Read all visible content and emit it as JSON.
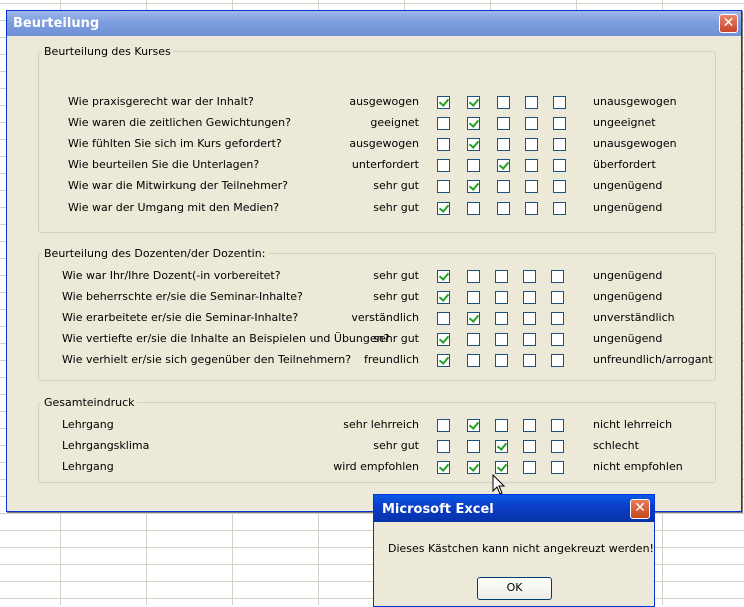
{
  "dialog": {
    "title": "Beurteilung",
    "close_glyph": "✕",
    "groups": [
      {
        "legend": "Beurteilung des Kurses",
        "rows": [
          {
            "question": "Wie praxisgerecht war der Inhalt?",
            "left": "ausgewogen",
            "right": "unausgewogen",
            "checks": [
              true,
              true,
              false,
              false,
              false
            ]
          },
          {
            "question": "Wie waren die zeitlichen Gewichtungen?",
            "left": "geeignet",
            "right": "ungeeignet",
            "checks": [
              false,
              true,
              false,
              false,
              false
            ]
          },
          {
            "question": "Wie fühlten Sie sich im Kurs gefordert?",
            "left": "ausgewogen",
            "right": "unausgewogen",
            "checks": [
              false,
              true,
              false,
              false,
              false
            ]
          },
          {
            "question": "Wie beurteilen Sie die Unterlagen?",
            "left": "unterfordert",
            "right": "überfordert",
            "checks": [
              false,
              false,
              true,
              false,
              false
            ]
          },
          {
            "question": "Wie war die Mitwirkung der Teilnehmer?",
            "left": "sehr gut",
            "right": "ungenügend",
            "checks": [
              false,
              true,
              false,
              false,
              false
            ]
          },
          {
            "question": "Wie war der Umgang mit den Medien?",
            "left": "sehr gut",
            "right": "ungenügend",
            "checks": [
              true,
              false,
              false,
              false,
              false
            ]
          }
        ]
      },
      {
        "legend": "Beurteilung des Dozenten/der Dozentin:",
        "rows": [
          {
            "question": "Wie war Ihr/Ihre Dozent(-in vorbereitet?",
            "left": "sehr gut",
            "right": "ungenügend",
            "checks": [
              true,
              false,
              false,
              false,
              false
            ]
          },
          {
            "question": "Wie beherrschte er/sie die Seminar-Inhalte?",
            "left": "sehr gut",
            "right": "ungenügend",
            "checks": [
              true,
              false,
              false,
              false,
              false
            ]
          },
          {
            "question": "Wie erarbeitete er/sie die Seminar-Inhalte?",
            "left": "verständlich",
            "right": "unverständlich",
            "checks": [
              false,
              true,
              false,
              false,
              false
            ]
          },
          {
            "question": "Wie vertiefte er/sie die Inhalte an Beispielen und Übungen?",
            "left": "sehr gut",
            "right": "ungenügend",
            "checks": [
              true,
              false,
              false,
              false,
              false
            ]
          },
          {
            "question": "Wie verhielt er/sie sich gegenüber den Teilnehmern?",
            "left": "freundlich",
            "right": "unfreundlich/arrogant",
            "checks": [
              true,
              false,
              false,
              false,
              false
            ]
          }
        ]
      },
      {
        "legend": "Gesamteindruck",
        "rows": [
          {
            "question": "Lehrgang",
            "left": "sehr lehrreich",
            "right": "nicht lehrreich",
            "checks": [
              false,
              true,
              false,
              false,
              false
            ]
          },
          {
            "question": "Lehrgangsklima",
            "left": "sehr gut",
            "right": "schlecht",
            "checks": [
              false,
              false,
              true,
              false,
              false
            ]
          },
          {
            "question": "Lehrgang",
            "left": "wird empfohlen",
            "right": "nicht empfohlen",
            "checks": [
              true,
              true,
              true,
              false,
              false
            ]
          }
        ]
      }
    ]
  },
  "message_box": {
    "title": "Microsoft Excel",
    "close_glyph": "✕",
    "text": "Dieses Kästchen kann nicht angekreuzt werden!",
    "ok_label": "OK"
  },
  "colors": {
    "dialog_bg": "#ece9d8",
    "title_inactive": "#7d9ede",
    "title_active": "#0a3fc8",
    "check_mark": "#21a121"
  }
}
